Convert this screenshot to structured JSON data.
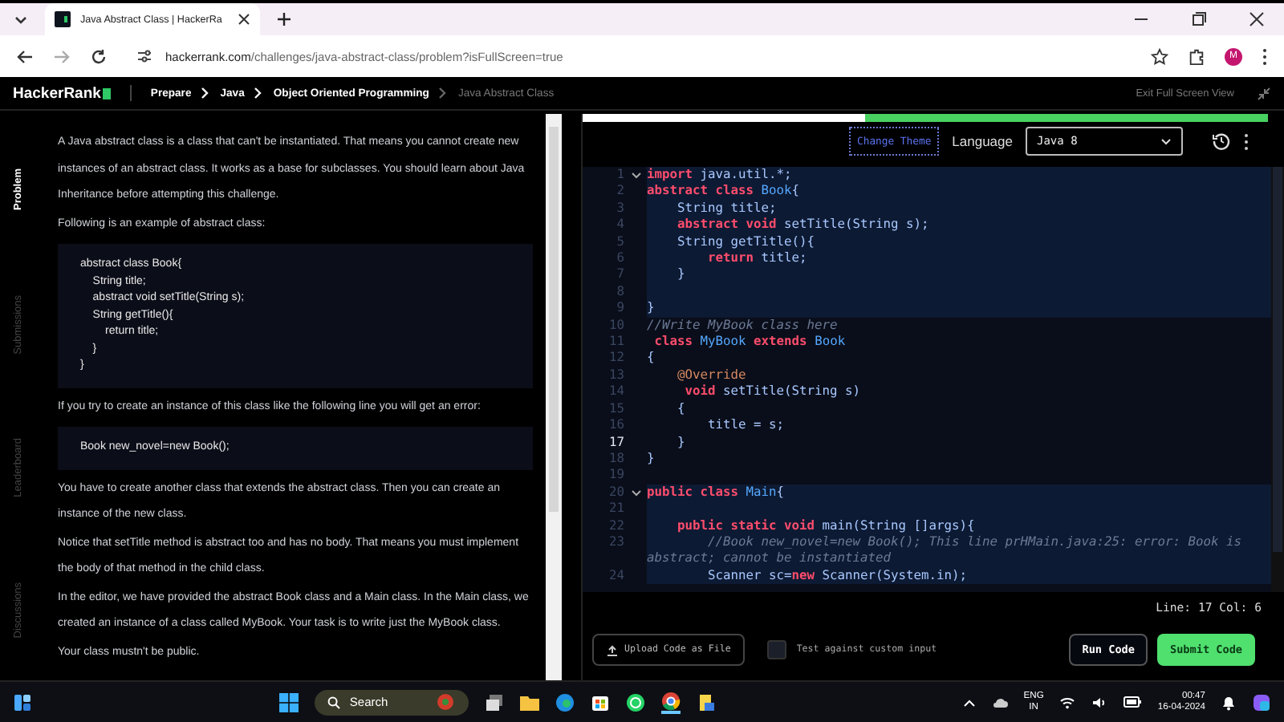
{
  "browser": {
    "tab_title": "Java Abstract Class | HackerRa",
    "url_host": "hackerrank.com",
    "url_path": "/challenges/java-abstract-class/problem?isFullScreen=true",
    "profile_initial": "M"
  },
  "nav": {
    "logo": "HackerRank",
    "breadcrumbs": [
      {
        "label": "Prepare",
        "current": false
      },
      {
        "label": "Java",
        "current": false
      },
      {
        "label": "Object Oriented Programming",
        "current": false
      },
      {
        "label": "Java Abstract Class",
        "current": true
      }
    ],
    "exit_label": "Exit Full Screen View"
  },
  "side_tabs": [
    {
      "label": "Problem",
      "selected": true
    },
    {
      "label": "Submissions",
      "selected": false
    },
    {
      "label": "Leaderboard",
      "selected": false
    },
    {
      "label": "Discussions",
      "selected": false
    }
  ],
  "problem": [
    {
      "kind": "paragraph",
      "text": "A Java abstract class is a class that can't be instantiated. That means you cannot create new instances of an abstract class. It works as a base for subclasses. You should learn about Java Inheritance before attempting this challenge."
    },
    {
      "kind": "paragraph",
      "text": "Following is an example of abstract class:"
    },
    {
      "kind": "code",
      "lines": [
        "abstract class Book{",
        "    String title;",
        "    abstract void setTitle(String s);",
        "    String getTitle(){",
        "        return title;",
        "    }",
        "}"
      ]
    },
    {
      "kind": "paragraph",
      "text": "If you try to create an instance of this class like the following line you will get an error:"
    },
    {
      "kind": "code",
      "lines": [
        "Book new_novel=new Book();"
      ]
    },
    {
      "kind": "paragraph",
      "text": "You have to create another class that extends the abstract class. Then you can create an instance of the new class."
    },
    {
      "kind": "paragraph",
      "text": "Notice that setTitle method is abstract too and has no body. That means you must implement the body of that method in the child class."
    },
    {
      "kind": "paragraph",
      "text": "In the editor, we have provided the abstract Book class and a Main class. In the Main class, we created an instance of a class called MyBook. Your task is to write just the MyBook class."
    },
    {
      "kind": "paragraph",
      "text": "Your class mustn't be public."
    }
  ],
  "editor": {
    "theme_button": "Change Theme",
    "language_label": "Language",
    "language": "Java 8",
    "lines": [
      {
        "number": "1",
        "foldable": true,
        "highlighted": true,
        "current": false,
        "tokens": [
          {
            "kind": "keyword",
            "text": "import"
          },
          {
            "kind": "plain",
            "text": " java.util.*;"
          }
        ]
      },
      {
        "number": "2",
        "foldable": false,
        "highlighted": true,
        "current": false,
        "tokens": [
          {
            "kind": "keyword",
            "text": "abstract class"
          },
          {
            "kind": "type",
            "text": " Book"
          },
          {
            "kind": "plain",
            "text": "{"
          }
        ]
      },
      {
        "number": "3",
        "foldable": false,
        "highlighted": true,
        "current": false,
        "tokens": [
          {
            "kind": "plain",
            "text": "    String title;"
          }
        ]
      },
      {
        "number": "4",
        "foldable": false,
        "highlighted": true,
        "current": false,
        "tokens": [
          {
            "kind": "keyword",
            "text": "    abstract void"
          },
          {
            "kind": "plain",
            "text": " setTitle(String s);"
          }
        ]
      },
      {
        "number": "5",
        "foldable": false,
        "highlighted": true,
        "current": false,
        "tokens": [
          {
            "kind": "plain",
            "text": "    String getTitle(){"
          }
        ]
      },
      {
        "number": "6",
        "foldable": false,
        "highlighted": true,
        "current": false,
        "tokens": [
          {
            "kind": "keyword",
            "text": "        return"
          },
          {
            "kind": "plain",
            "text": " title;"
          }
        ]
      },
      {
        "number": "7",
        "foldable": false,
        "highlighted": true,
        "current": false,
        "tokens": [
          {
            "kind": "plain",
            "text": "    }"
          }
        ]
      },
      {
        "number": "8",
        "foldable": false,
        "highlighted": true,
        "current": false
      },
      {
        "number": "9",
        "foldable": false,
        "highlighted": true,
        "current": false,
        "tokens": [
          {
            "kind": "plain",
            "text": "}"
          }
        ]
      },
      {
        "number": "10",
        "foldable": false,
        "highlighted": false,
        "current": false,
        "tokens": [
          {
            "kind": "comment",
            "text": "//Write MyBook class here"
          }
        ]
      },
      {
        "number": "11",
        "foldable": false,
        "highlighted": false,
        "current": false,
        "tokens": [
          {
            "kind": "keyword",
            "text": " class"
          },
          {
            "kind": "type",
            "text": " MyBook"
          },
          {
            "kind": "keyword",
            "text": " extends"
          },
          {
            "kind": "type",
            "text": " Book"
          }
        ]
      },
      {
        "number": "12",
        "foldable": false,
        "highlighted": false,
        "current": false,
        "tokens": [
          {
            "kind": "plain",
            "text": "{"
          }
        ]
      },
      {
        "number": "13",
        "foldable": false,
        "highlighted": false,
        "current": false,
        "tokens": [
          {
            "kind": "annotation",
            "text": "    @Override"
          }
        ]
      },
      {
        "number": "14",
        "foldable": false,
        "highlighted": false,
        "current": false,
        "tokens": [
          {
            "kind": "keyword",
            "text": "     void"
          },
          {
            "kind": "plain",
            "text": " setTitle(String s)"
          }
        ]
      },
      {
        "number": "15",
        "foldable": false,
        "highlighted": false,
        "current": false,
        "tokens": [
          {
            "kind": "plain",
            "text": "    {"
          }
        ]
      },
      {
        "number": "16",
        "foldable": false,
        "highlighted": false,
        "current": false,
        "tokens": [
          {
            "kind": "plain",
            "text": "        title = s;"
          }
        ]
      },
      {
        "number": "17",
        "foldable": false,
        "highlighted": false,
        "current": true,
        "tokens": [
          {
            "kind": "plain",
            "text": "    }"
          }
        ]
      },
      {
        "number": "18",
        "foldable": false,
        "highlighted": false,
        "current": false,
        "tokens": [
          {
            "kind": "plain",
            "text": "}"
          }
        ]
      },
      {
        "number": "19",
        "foldable": false,
        "highlighted": false,
        "current": false
      },
      {
        "number": "20",
        "foldable": true,
        "highlighted": true,
        "current": false,
        "tokens": [
          {
            "kind": "keyword",
            "text": "public class"
          },
          {
            "kind": "type",
            "text": " Main"
          },
          {
            "kind": "plain",
            "text": "{"
          }
        ]
      },
      {
        "number": "21",
        "foldable": false,
        "highlighted": true,
        "current": false
      },
      {
        "number": "22",
        "foldable": false,
        "highlighted": true,
        "current": false,
        "tokens": [
          {
            "kind": "keyword",
            "text": "    public static void"
          },
          {
            "kind": "plain",
            "text": " main(String []args){"
          }
        ]
      },
      {
        "number": "23",
        "foldable": false,
        "highlighted": true,
        "current": false,
        "tokens": [
          {
            "kind": "comment",
            "text": "        //Book new_novel=new Book(); This line prHMain.java:25: error: Book is abstract; cannot be instantiated"
          }
        ]
      },
      {
        "number": "24",
        "foldable": false,
        "highlighted": true,
        "current": false,
        "tokens": [
          {
            "kind": "plain",
            "text": "        Scanner sc="
          },
          {
            "kind": "keyword",
            "text": "new"
          },
          {
            "kind": "plain",
            "text": " Scanner(System.in);"
          }
        ]
      }
    ],
    "cursor_status": "Line: 17 Col: 6",
    "upload_button": "Upload Code as File",
    "custom_input": {
      "label": "Test against custom input",
      "checked": false
    },
    "run_button": "Run Code",
    "submit_button": "Submit Code"
  },
  "taskbar": {
    "search_placeholder": "Search",
    "language": "ENG",
    "region": "IN",
    "time": "00:47",
    "date": "16-04-2024"
  }
}
